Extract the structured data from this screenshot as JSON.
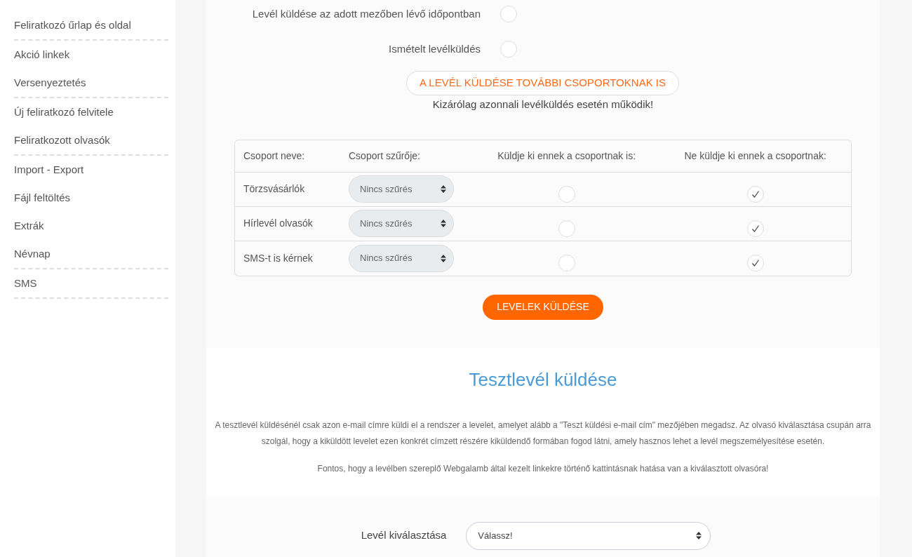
{
  "sidebar": {
    "items": [
      {
        "label": "Feliratkozó űrlap és oldal",
        "divider_after": true
      },
      {
        "label": "Akció linkek",
        "divider_after": false
      },
      {
        "label": "Versenyeztetés",
        "divider_after": true
      },
      {
        "label": "Új feliratkozó felvitele",
        "divider_after": false
      },
      {
        "label": "Feliratkozott olvasók",
        "divider_after": true
      },
      {
        "label": "Import - Export",
        "divider_after": false
      },
      {
        "label": "Fájl feltöltés",
        "divider_after": false
      },
      {
        "label": "Extrák",
        "divider_after": false
      },
      {
        "label": "Névnap",
        "divider_after": true
      },
      {
        "label": "SMS",
        "divider_after": true
      }
    ]
  },
  "options": [
    {
      "label": "Levél küldése az adott mezőben lévő időpontban",
      "checked": false
    },
    {
      "label": "Ismételt levélküldés",
      "checked": false
    }
  ],
  "more_groups_button": "A LEVÉL KÜLDÉSE TOVÁBBI CSOPORTOKNAK IS",
  "more_groups_note": "Kizárólag azonnali levélküldés esetén működik!",
  "groups_table": {
    "columns": [
      "Csoport neve:",
      "Csoport szűrője:",
      "Küldje ki ennek a csoportnak is:",
      "Ne küldje ki ennek a csoportnak:"
    ],
    "rows": [
      {
        "name": "Törzsvásárlók",
        "filter": "Nincs szűrés",
        "send": false,
        "exclude": true
      },
      {
        "name": "Hírlevél olvasók",
        "filter": "Nincs szűrés",
        "send": false,
        "exclude": true
      },
      {
        "name": "SMS-t is kérnek",
        "filter": "Nincs szűrés",
        "send": false,
        "exclude": true
      }
    ]
  },
  "send_button": "LEVELEK KÜLDÉSE",
  "test_section": {
    "title": "Tesztlevél küldése",
    "paragraphs": [
      "A tesztlevél küldésénél csak azon e-mail címre küldi el a rendszer a levelet, amelyet alább a \"Teszt küldési e-mail cím\" mezőjében megadsz. Az olvasó kiválasztása csupán arra szolgál, hogy a kiküldött levelet ezen konkrét címzett részére kiküldendő formában fogod látni, amely hasznos lehet a levél megszemélyesítése esetén.",
      "Fontos, hogy a levélben szereplő Webgalamb által kezelt linkekre történő kattintásnak hatása van a kiválasztott olvasóra!"
    ],
    "letter_select": {
      "label": "Levél kiválasztása",
      "value": "Válassz!"
    }
  }
}
